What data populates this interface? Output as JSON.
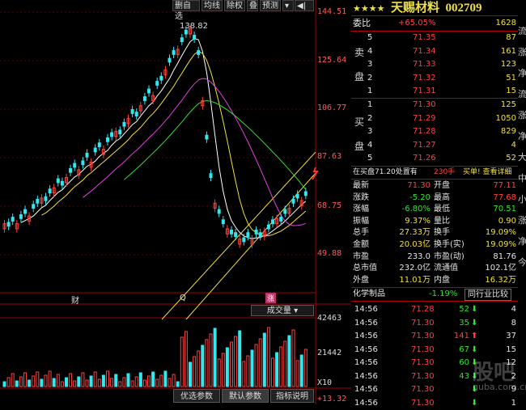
{
  "toolbar": {
    "items": [
      "删自选",
      "均线",
      "除权",
      "叠",
      "预测"
    ]
  },
  "price_axis": {
    "labels": [
      "144.51",
      "125.64",
      "106.77",
      "87.63",
      "68.75",
      "49.88"
    ]
  },
  "chart": {
    "peak_label": "138.82",
    "markers": [
      "财",
      "Q",
      "涨"
    ]
  },
  "volume": {
    "dropdown": "成交量",
    "axis": [
      "42463",
      "21442",
      "X10"
    ]
  },
  "bottom_tabs": [
    "优选参数",
    "默认参数",
    "指标说明"
  ],
  "bottom_axis_value": "+13.32",
  "header": {
    "stars": "★★★★",
    "name": "天赐材料",
    "code": "002709"
  },
  "order_ratio": {
    "label": "委比",
    "value": "+65.05%",
    "volume": "1628"
  },
  "sell_side": {
    "label": [
      "卖",
      "盘"
    ],
    "rows": [
      {
        "level": "5",
        "price": "71.35",
        "vol": "87"
      },
      {
        "level": "4",
        "price": "71.34",
        "vol": "161"
      },
      {
        "level": "3",
        "price": "71.33",
        "vol": "123"
      },
      {
        "level": "2",
        "price": "71.32",
        "vol": "51"
      },
      {
        "level": "1",
        "price": "71.31",
        "vol": "15"
      }
    ]
  },
  "buy_side": {
    "label": [
      "买",
      "盘"
    ],
    "rows": [
      {
        "level": "1",
        "price": "71.30",
        "vol": "125"
      },
      {
        "level": "2",
        "price": "71.29",
        "vol": "1050"
      },
      {
        "level": "3",
        "price": "71.28",
        "vol": "829"
      },
      {
        "level": "4",
        "price": "71.27",
        "vol": "4"
      },
      {
        "level": "5",
        "price": "71.26",
        "vol": "52"
      }
    ]
  },
  "notice": {
    "left": "在买盘71.20处置有",
    "amount": "230手",
    "right": "买单! 查看详细"
  },
  "stats": [
    {
      "l1": "最新",
      "v1": "71.30",
      "l2": "开盘",
      "v2": "77.11"
    },
    {
      "l1": "涨跌",
      "v1": "-5.20",
      "l2": "最高",
      "v2": "77.68"
    },
    {
      "l1": "涨幅",
      "v1": "-6.80%",
      "l2": "最低",
      "v2": "70.51"
    },
    {
      "l1": "振幅",
      "v1": "9.37%",
      "l2": "量比",
      "v2": "0.90"
    },
    {
      "l1": "总手",
      "v1": "27.33万",
      "l2": "换手",
      "v2": "19.09%"
    },
    {
      "l1": "金额",
      "v1": "20.03亿",
      "l2": "换手(实)",
      "v2": "19.09%"
    },
    {
      "l1": "市盈",
      "v1": "233.0",
      "l2": "市盈(动)",
      "v2": "81.76"
    },
    {
      "l1": "总市值",
      "v1": "232.0亿",
      "l2": "流通值",
      "v2": "102.1亿"
    },
    {
      "l1": "外盘",
      "v1": "11.01万",
      "l2": "内盘",
      "v2": "16.32万"
    }
  ],
  "industry": {
    "name": "化学制品",
    "change": "-1.19%",
    "button": "同行业比较"
  },
  "ticks": [
    {
      "time": "14:56",
      "price": "71.28",
      "vol": "52",
      "dir": "down",
      "n": "4"
    },
    {
      "time": "14:56",
      "price": "71.30",
      "vol": "35",
      "dir": "down",
      "n": "8"
    },
    {
      "time": "14:56",
      "price": "71.30",
      "vol": "141",
      "dir": "up",
      "n": "37"
    },
    {
      "time": "14:56",
      "price": "71.30",
      "vol": "67",
      "dir": "down",
      "n": "15"
    },
    {
      "time": "14:56",
      "price": "71.30",
      "vol": "60",
      "dir": "down",
      "n": "12"
    },
    {
      "time": "14:56",
      "price": "71.30",
      "vol": "43",
      "dir": "down",
      "n": "2"
    },
    {
      "time": "14:56",
      "price": "71.30",
      "vol": "",
      "dir": "down",
      "n": "9"
    },
    {
      "time": "14:56",
      "price": "71.30",
      "vol": "",
      "dir": "down",
      "n": "1"
    }
  ],
  "right_edge": [
    "流",
    "涨",
    "净",
    "流",
    "涨",
    "净",
    "大",
    "中",
    "小",
    "涨",
    "净",
    "今"
  ],
  "watermark": "股吧 guba.com.cn",
  "colors": {
    "up": "#ff4040",
    "down": "#2ee62e",
    "ma5": "#ffffff",
    "ma10": "#f0e040",
    "ma20": "#e040e0",
    "ma30": "#30e030"
  }
}
